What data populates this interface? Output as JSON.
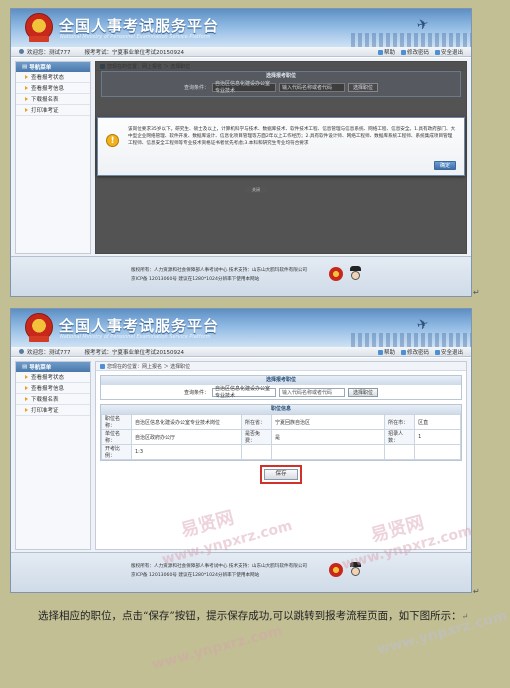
{
  "site": {
    "title": "全国人事考试服务平台",
    "subtitle": "National Ministry of Personnel Examination Service Platform"
  },
  "userbar": {
    "welcome": "欢迎您：测试777",
    "exam": "报考考试：宁夏事业单位考试20150924",
    "links": [
      "帮助",
      "修改密码",
      "安全退出"
    ]
  },
  "sidebar": {
    "header": "导航菜单",
    "items": [
      "查看报考状态",
      "查看报考信息",
      "下载报名表",
      "打印准考证"
    ]
  },
  "breadcrumb": "您现在的位置：网上报名 ＞ 选择职位",
  "query": {
    "panel_title": "选择报考职位",
    "label": "查询条件：",
    "select_value": "自治区信息化建设办公室专业技术",
    "input_placeholder": "输入代码名称或者代码",
    "button": "选择职位"
  },
  "alert": {
    "message": "该岗位要求35岁以下。研究生、硕士及以上，计算机科学与技术、数据库技术、软件技术工程、信息管理与信息系统、网络工程、信息安全。1.具有政府部门、大中型企业网络管理、软件开发、数据库设计、信息化项目管理等方面2年以上工作经历；2.具有软件设计师、网络工程师、数据库系统工程师、系统集成项目管理工程师、信息安全工程师等专业技术资格证书者优先考虑;3.本科和研究生专业均符合要求",
    "ok": "确定",
    "closebar": "关闭"
  },
  "position_info": {
    "title": "职位信息",
    "rows": [
      [
        {
          "k": "职位名称：",
          "v": "自治区信息化建设办公室专业技术岗位"
        },
        {
          "k": "所在省：",
          "v": "宁夏回族自治区"
        },
        {
          "k": "所在市：",
          "v": "区直"
        }
      ],
      [
        {
          "k": "单位名称：",
          "v": "自治区政府办公厅"
        },
        {
          "k": "是否免费：",
          "v": "是"
        },
        {
          "k": "招录人数：",
          "v": "1"
        }
      ],
      [
        {
          "k": "开考比例：",
          "v": "1:3"
        }
      ]
    ],
    "save_button": "保存"
  },
  "footer": {
    "line1": "版权所有：人力资源和社会保障部人事考试中心  技术支持：山东山大鸥玛软件有限公司",
    "line2": "京ICP备 12013060号  建议在1280*1024分辨率下使用本网站"
  },
  "caption": "选择相应的职位，点击“保存”按钮，提示保存成功,可以跳转到报考流程页面，如下图所示：",
  "return_mark": "↵",
  "watermarks": [
    "易贤网",
    "www.ynpxrz.com"
  ]
}
